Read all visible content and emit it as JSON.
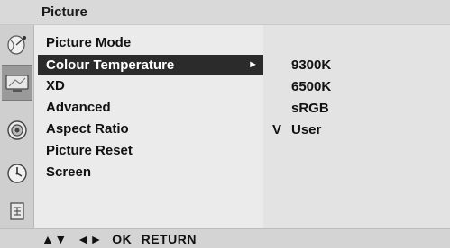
{
  "header": {
    "title": "Picture"
  },
  "sidebar": {
    "icons": [
      {
        "name": "satellite-dish-icon"
      },
      {
        "name": "tv-screen-icon",
        "active": true
      },
      {
        "name": "speaker-icon"
      },
      {
        "name": "clock-icon"
      },
      {
        "name": "lock-icon"
      }
    ]
  },
  "menu": {
    "items": [
      {
        "label": "Picture Mode"
      },
      {
        "label": "Colour Temperature",
        "selected": true,
        "arrow": "►"
      },
      {
        "label": "XD"
      },
      {
        "label": "Advanced"
      },
      {
        "label": "Aspect Ratio"
      },
      {
        "label": "Picture Reset"
      },
      {
        "label": "Screen"
      }
    ]
  },
  "submenu": {
    "options": [
      {
        "label": "9300K"
      },
      {
        "label": "6500K"
      },
      {
        "label": "sRGB"
      },
      {
        "label": "User",
        "checked": true,
        "check_mark": "V"
      }
    ]
  },
  "footer": {
    "nav_arrows_ud": "▲▼",
    "nav_arrows_lr": "◄►",
    "ok": "OK",
    "return": "RETURN"
  }
}
